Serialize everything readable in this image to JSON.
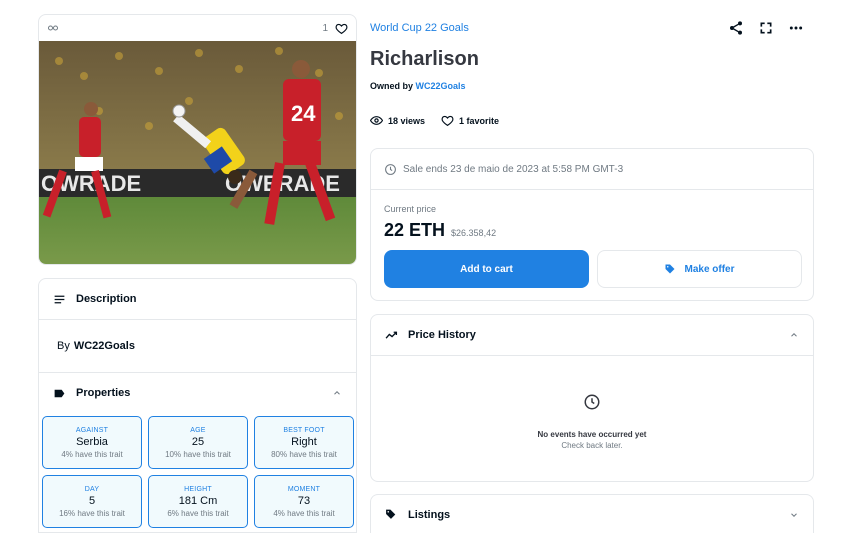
{
  "media": {
    "favorite_count": "1",
    "image_alt": "Bicycle kick in a World Cup match"
  },
  "description": {
    "title": "Description",
    "by_prefix": "By",
    "creator": "WC22Goals"
  },
  "properties": {
    "title": "Properties",
    "traits": [
      {
        "type": "AGAINST",
        "value": "Serbia",
        "rarity": "4% have this trait"
      },
      {
        "type": "AGE",
        "value": "25",
        "rarity": "10% have this trait"
      },
      {
        "type": "BEST FOOT",
        "value": "Right",
        "rarity": "80% have this trait"
      },
      {
        "type": "DAY",
        "value": "5",
        "rarity": "16% have this trait"
      },
      {
        "type": "HEIGHT",
        "value": "181 Cm",
        "rarity": "6% have this trait"
      },
      {
        "type": "MOMENT",
        "value": "73",
        "rarity": "4% have this trait"
      }
    ]
  },
  "collection": "World Cup 22 Goals",
  "item": {
    "title": "Richarlison",
    "owned_by_prefix": "Owned by",
    "owner": "WC22Goals",
    "views": "18 views",
    "favorites": "1 favorite"
  },
  "sale": {
    "ends_text": "Sale ends 23 de maio de 2023 at 5:58 PM GMT-3",
    "price_label": "Current price",
    "price": "22 ETH",
    "price_fiat": "$26.358,42",
    "add_to_cart": "Add to cart",
    "make_offer": "Make offer"
  },
  "price_history": {
    "title": "Price History",
    "empty_title": "No events have occurred yet",
    "empty_sub": "Check back later."
  },
  "listings": {
    "title": "Listings"
  },
  "colors": {
    "accent": "#2081e2",
    "text": "#04111d",
    "muted": "#707a83",
    "border": "#e5e8eb"
  }
}
